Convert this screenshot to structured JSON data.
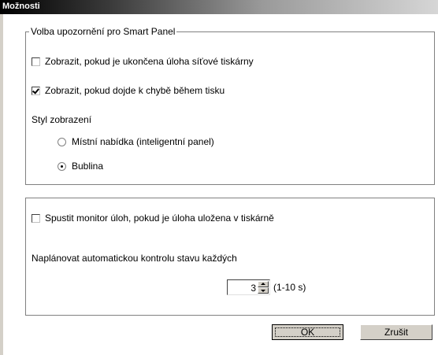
{
  "window": {
    "title": "Možnosti"
  },
  "notifications": {
    "legend": "Volba upozornění pro Smart Panel",
    "options": [
      {
        "label": "Zobrazit, pokud je ukončena úloha síťové tiskárny",
        "checked": false
      },
      {
        "label": "Zobrazit, pokud dojde k chybě během tisku",
        "checked": true
      }
    ],
    "style_label": "Styl zobrazení",
    "styles": [
      {
        "label": "Místní nabídka (inteligentní panel)",
        "selected": false
      },
      {
        "label": "Bublina",
        "selected": true
      }
    ]
  },
  "monitor": {
    "start_label": "Spustit monitor úloh, pokud je úloha uložena v tiskárně",
    "start_checked": false,
    "schedule_label": "Naplánovat automatickou kontrolu stavu každých",
    "interval_value": "3",
    "interval_hint": "(1-10 s)"
  },
  "buttons": {
    "ok": "OK",
    "cancel": "Zrušit"
  }
}
